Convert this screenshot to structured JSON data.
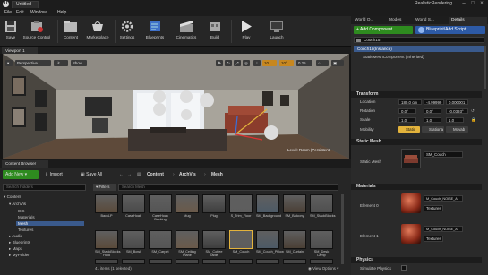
{
  "title_bar": {
    "logo_letter": "U",
    "document_tab": "Untitled",
    "project_name": "RealisticRendering"
  },
  "menu": [
    "File",
    "Edit",
    "Window",
    "Help"
  ],
  "toolbar": [
    {
      "label": "Save",
      "icon": "save-icon"
    },
    {
      "label": "Source Control",
      "icon": "source-control-icon"
    },
    {
      "label": "Content",
      "icon": "content-icon"
    },
    {
      "label": "Marketplace",
      "icon": "marketplace-icon"
    },
    {
      "label": "Settings",
      "icon": "settings-icon"
    },
    {
      "label": "Blueprints",
      "icon": "blueprints-icon"
    },
    {
      "label": "Cinematics",
      "icon": "cinematics-icon"
    },
    {
      "label": "Build",
      "icon": "build-icon"
    },
    {
      "label": "Play",
      "icon": "play-icon"
    },
    {
      "label": "Launch",
      "icon": "launch-icon"
    }
  ],
  "right_tabs": [
    "World O...",
    "Modes",
    "World S...",
    "Details"
  ],
  "details": {
    "add_component": "+ Add Component",
    "blueprint_script": "Blueprint/Add Script",
    "actor_name": "Couch15",
    "instance_row": "Couch15(Instance)",
    "component_row": "StaticMeshComponent (Inherited)",
    "transform_header": "Transform",
    "location_label": "Location",
    "location_values": [
      "180.0 cm",
      "-4.99999",
      "0.000001"
    ],
    "rotation_label": "Rotation",
    "rotation_values": [
      "0.0°",
      "0.0°",
      "-0.0393°"
    ],
    "scale_label": "Scale",
    "scale_values": [
      "1.0",
      "1.0",
      "1.0"
    ],
    "mobility_label": "Mobility",
    "mobility_options": [
      "Static",
      "Stationa",
      "Movab"
    ],
    "static_mesh_header": "Static Mesh",
    "static_mesh_label": "Static Mesh",
    "static_mesh_value": "SM_Couch",
    "materials_header": "Materials",
    "element0_label": "Element 0",
    "element0_value": "M_Couch_NOISE_A",
    "element1_label": "Element 1",
    "element1_value": "M_Couch_NOISE_A",
    "textures_label": "Textures",
    "physics_header": "Physics",
    "simulate_physics": "Simulate Physics"
  },
  "viewport": {
    "tab": "Viewport 1",
    "perspective": "Perspective",
    "lit": "Lit",
    "show": "Show",
    "grid_snap": "10",
    "rot_snap": "10°",
    "scale_snap": "0.25",
    "level_text": "Level: Room (Persistent)"
  },
  "content_browser": {
    "tab": "Content Browser",
    "add_new": "Add New",
    "import": "Import",
    "save_all": "Save All",
    "breadcrumb": [
      "Content",
      "ArchVis",
      "Mesh"
    ],
    "filters": "Filters",
    "search_placeholder": "Search Mesh",
    "folder_search_placeholder": "Search Folders",
    "folders": [
      "Content",
      "ArchVis",
      "IES",
      "Materials",
      "Mesh",
      "Textures",
      "Audio",
      "Blueprints",
      "Maps",
      "MyFolder"
    ],
    "assets": [
      "BackLP",
      "CaseHoak",
      "CaseHoak Backing",
      "Mug",
      "Plug",
      "S_Trim_Floor",
      "SM_Background",
      "SM_Balcony",
      "SM_StackBlocks",
      "SM_StackBlocks Hold",
      "SM_Bowl",
      "SM_Carpet",
      "SM_Ceiling Plane",
      "SM_Coffee Table",
      "SM_Couch",
      "SM_Couch_Pillow",
      "SM_Curtain",
      "SM_Desk Lamp"
    ],
    "item_count": "41 items (1 selected)",
    "view_options": "View Options"
  },
  "colors": {
    "accent_green": "#2e8b1f",
    "accent_blue": "#2d5aa6",
    "selection_orange": "#e3b33c"
  }
}
